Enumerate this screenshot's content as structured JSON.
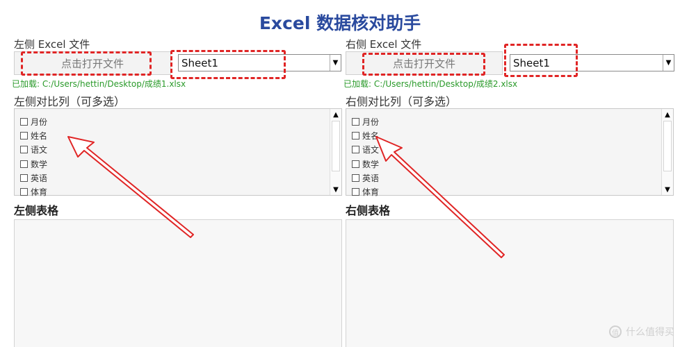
{
  "app": {
    "title": "Excel 数据核对助手"
  },
  "left": {
    "file_label": "左侧 Excel 文件",
    "open_button": "点击打开文件",
    "sheet": "Sheet1",
    "loaded": "已加载: C:/Users/hettin/Desktop/成绩1.xlsx",
    "columns_label": "左侧对比列（可多选）",
    "columns": [
      "月份",
      "姓名",
      "语文",
      "数学",
      "英语",
      "体育"
    ],
    "table_label": "左侧表格"
  },
  "right": {
    "file_label": "右侧 Excel 文件",
    "open_button": "点击打开文件",
    "sheet": "Sheet1",
    "loaded": "已加载: C:/Users/hettin/Desktop/成绩2.xlsx",
    "columns_label": "右侧对比列（可多选）",
    "columns": [
      "月份",
      "姓名",
      "语文",
      "数学",
      "英语",
      "体育"
    ],
    "table_label": "右侧表格"
  },
  "icons": {
    "dropdown": "chevron-down-icon",
    "scroll_up": "scroll-up-icon",
    "scroll_down": "scroll-down-icon"
  },
  "annotation_color": "#e02525",
  "watermark": {
    "text": "什么值得买",
    "icon": "值"
  }
}
